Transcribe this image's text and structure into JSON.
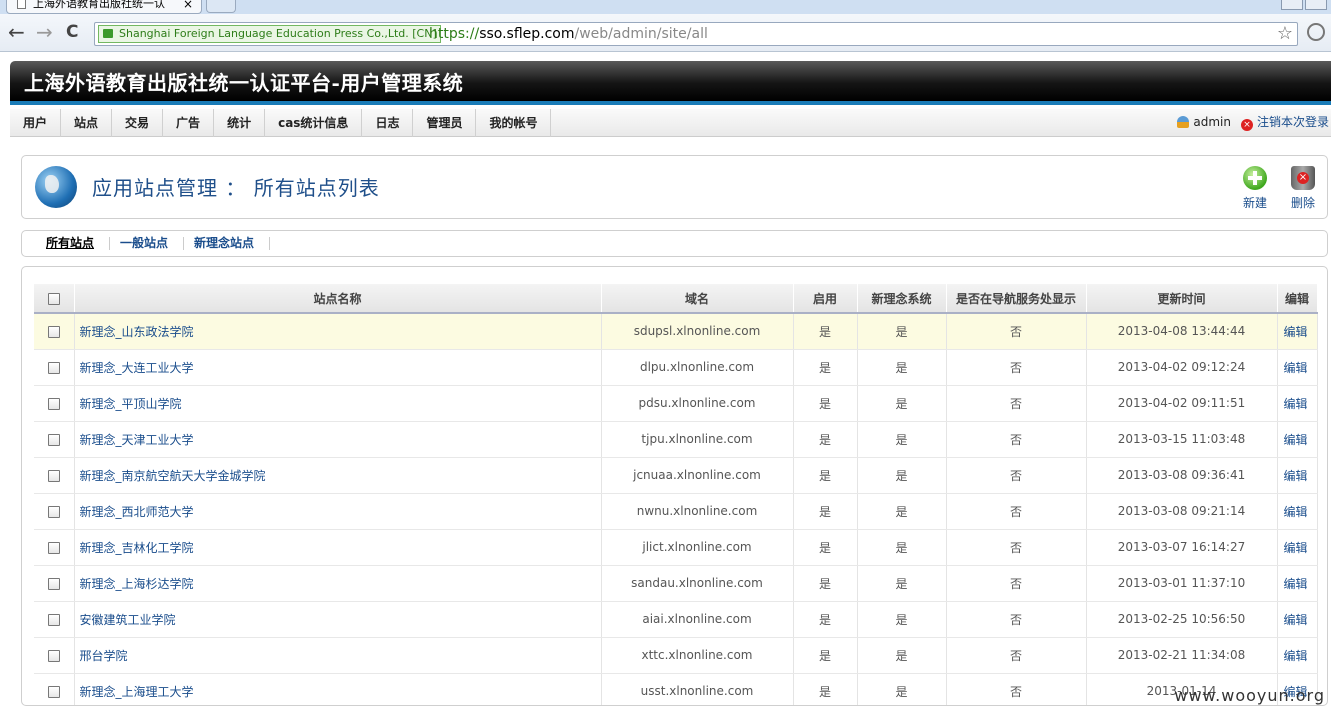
{
  "browser": {
    "tab_title": "上海外语教育出版社统一认",
    "tab_close": "×",
    "ev_badge": "Shanghai Foreign Language Education Press Co.,Ltd. [CN]",
    "url_proto": "https://",
    "url_host": "sso.sflep.com",
    "url_path": "/web/admin/site/all",
    "back": "←",
    "forward": "→",
    "reload": "C",
    "star": "☆"
  },
  "header": {
    "title": "上海外语教育出版社统一认证平台-用户管理系统"
  },
  "menu": {
    "items": [
      "用户",
      "站点",
      "交易",
      "广告",
      "统计",
      "cas统计信息",
      "日志",
      "管理员",
      "我的帐号"
    ],
    "user": "admin",
    "logout": "注销本次登录"
  },
  "page": {
    "heading": "应用站点管理 ： 所有站点列表",
    "new_label": "新建",
    "delete_label": "删除"
  },
  "subtabs": [
    "所有站点",
    "一般站点",
    "新理念站点"
  ],
  "table": {
    "headers": [
      "站点名称",
      "域名",
      "启用",
      "新理念系统",
      "是否在导航服务处显示",
      "更新时间",
      "编辑"
    ],
    "rows": [
      {
        "name": "新理念_山东政法学院",
        "domain": "sdupsl.xlnonline.com",
        "enabled": "是",
        "xlx": "是",
        "nav": "否",
        "updated": "2013-04-08 13:44:44",
        "edit": "编辑"
      },
      {
        "name": "新理念_大连工业大学",
        "domain": "dlpu.xlnonline.com",
        "enabled": "是",
        "xlx": "是",
        "nav": "否",
        "updated": "2013-04-02 09:12:24",
        "edit": "编辑"
      },
      {
        "name": "新理念_平顶山学院",
        "domain": "pdsu.xlnonline.com",
        "enabled": "是",
        "xlx": "是",
        "nav": "否",
        "updated": "2013-04-02 09:11:51",
        "edit": "编辑"
      },
      {
        "name": "新理念_天津工业大学",
        "domain": "tjpu.xlnonline.com",
        "enabled": "是",
        "xlx": "是",
        "nav": "否",
        "updated": "2013-03-15 11:03:48",
        "edit": "编辑"
      },
      {
        "name": "新理念_南京航空航天大学金城学院",
        "domain": "jcnuaa.xlnonline.com",
        "enabled": "是",
        "xlx": "是",
        "nav": "否",
        "updated": "2013-03-08 09:36:41",
        "edit": "编辑"
      },
      {
        "name": "新理念_西北师范大学",
        "domain": "nwnu.xlnonline.com",
        "enabled": "是",
        "xlx": "是",
        "nav": "否",
        "updated": "2013-03-08 09:21:14",
        "edit": "编辑"
      },
      {
        "name": "新理念_吉林化工学院",
        "domain": "jlict.xlnonline.com",
        "enabled": "是",
        "xlx": "是",
        "nav": "否",
        "updated": "2013-03-07 16:14:27",
        "edit": "编辑"
      },
      {
        "name": "新理念_上海杉达学院",
        "domain": "sandau.xlnonline.com",
        "enabled": "是",
        "xlx": "是",
        "nav": "否",
        "updated": "2013-03-01 11:37:10",
        "edit": "编辑"
      },
      {
        "name": "安徽建筑工业学院",
        "domain": "aiai.xlnonline.com",
        "enabled": "是",
        "xlx": "是",
        "nav": "否",
        "updated": "2013-02-25 10:56:50",
        "edit": "编辑"
      },
      {
        "name": "邢台学院",
        "domain": "xttc.xlnonline.com",
        "enabled": "是",
        "xlx": "是",
        "nav": "否",
        "updated": "2013-02-21 11:34:08",
        "edit": "编辑"
      },
      {
        "name": "新理念_上海理工大学",
        "domain": "usst.xlnonline.com",
        "enabled": "是",
        "xlx": "是",
        "nav": "否",
        "updated": "2013-01-14",
        "edit": "编辑"
      }
    ]
  },
  "watermark": "www.wooyun.org"
}
